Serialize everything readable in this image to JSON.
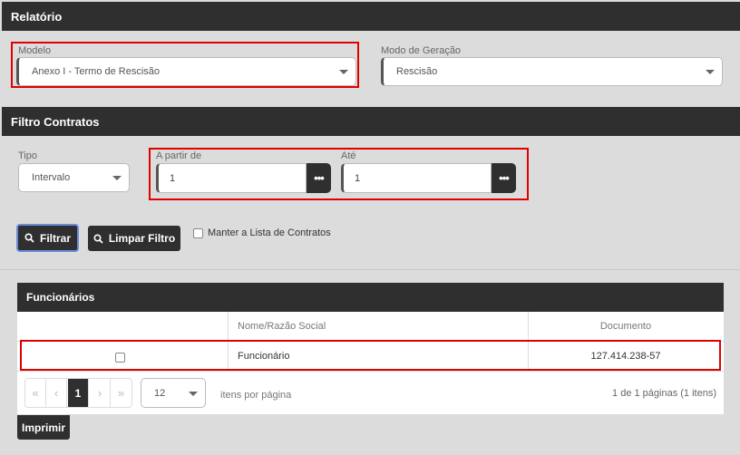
{
  "relatorio": {
    "title": "Relatório",
    "modelo_label": "Modelo",
    "modelo_value": "Anexo I - Termo de Rescisão",
    "modo_label": "Modo de Geração",
    "modo_value": "Rescisão"
  },
  "filtro": {
    "title": "Filtro Contratos",
    "tipo_label": "Tipo",
    "tipo_value": "Intervalo",
    "apartir_label": "A partir de",
    "apartir_value": "1",
    "ate_label": "Até",
    "ate_value": "1",
    "dots": "•••",
    "filtrar_label": "Filtrar",
    "limpar_label": "Limpar Filtro",
    "manter_label": "Manter a Lista de Contratos"
  },
  "funcionarios": {
    "title": "Funcionários",
    "columns": [
      "",
      "Nome/Razão Social",
      "Documento"
    ],
    "rows": [
      {
        "nome": "Funcionário",
        "documento": "127.414.238-57"
      }
    ],
    "pager": {
      "first": "«",
      "prev": "‹",
      "page": "1",
      "next": "›",
      "last": "»",
      "page_size": "12",
      "per_page_label": "itens por página",
      "summary": "1 de 1 páginas (1 itens)"
    },
    "imprimir_label": "Imprimir"
  },
  "colors": {
    "header": "#2f2f2f",
    "highlight": "#e00000",
    "background": "#dcdcdc"
  }
}
